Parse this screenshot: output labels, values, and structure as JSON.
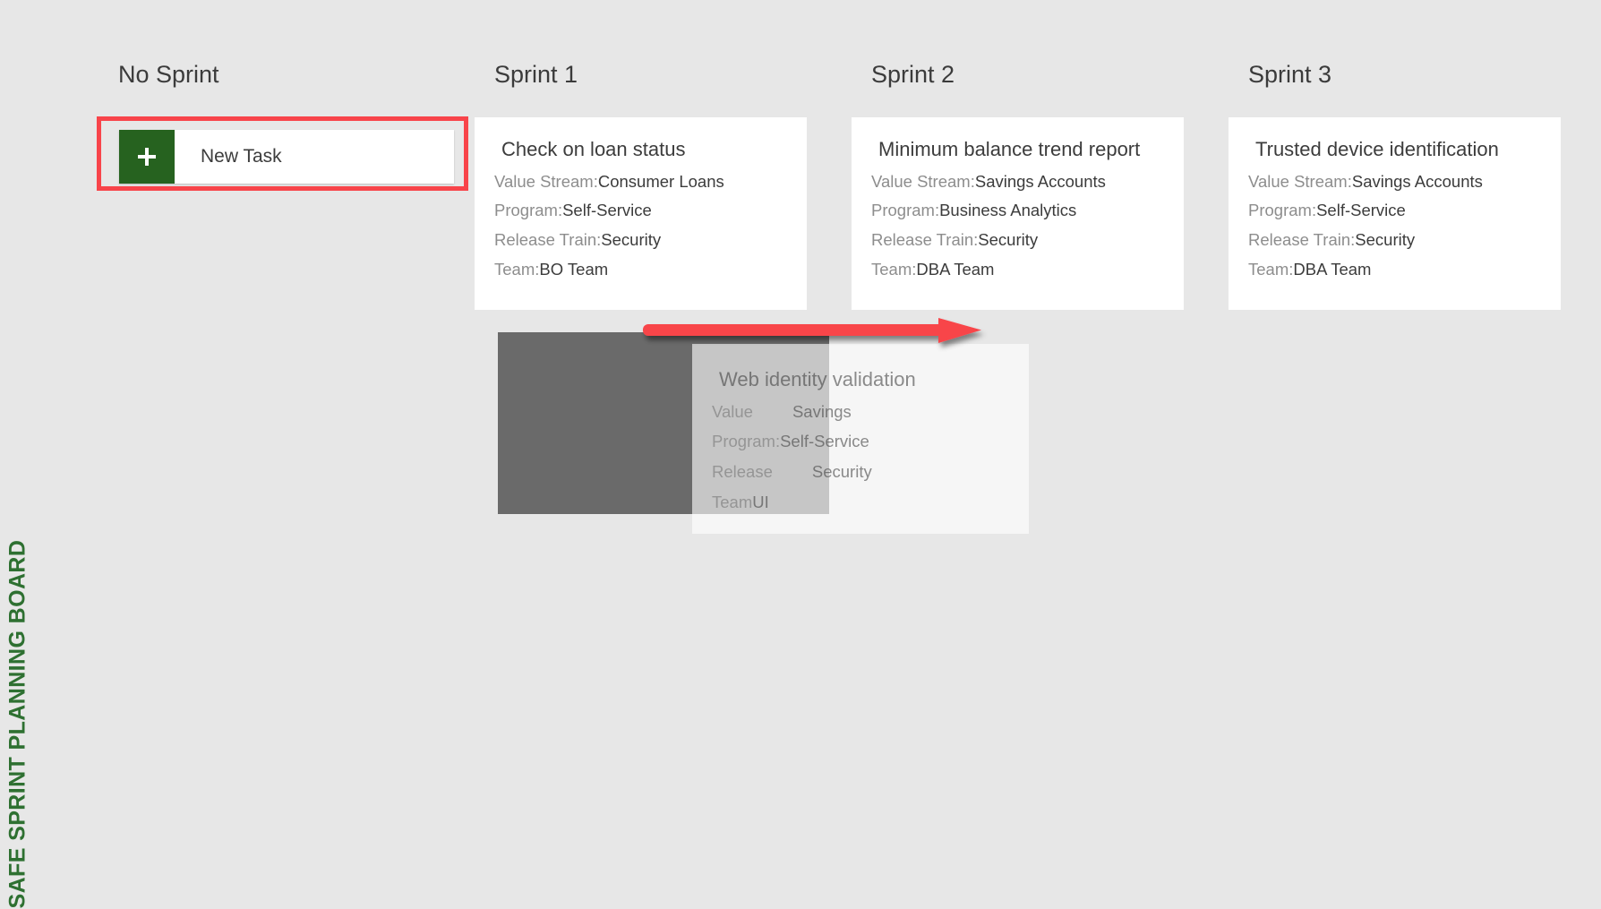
{
  "board": {
    "caption": "SAFE SPRINT PLANNING BOARD",
    "caption_color": "#2e7031",
    "background_color": "#e7e7e7",
    "card_background": "#ffffff",
    "highlight_color": "#f8444a",
    "accent_green": "#26621f"
  },
  "columns": [
    {
      "title": "No Sprint",
      "cards": []
    },
    {
      "title": "Sprint 1",
      "cards": [
        {
          "title": "Check on loan status",
          "fields": [
            {
              "label": "Value Stream:",
              "value": "Consumer Loans"
            },
            {
              "label": "Program:",
              "value": "Self-Service"
            },
            {
              "label": "Release Train:",
              "value": "Security"
            },
            {
              "label": "Team:",
              "value": "BO Team"
            }
          ]
        }
      ]
    },
    {
      "title": "Sprint 2",
      "cards": [
        {
          "title": "Minimum balance trend report",
          "fields": [
            {
              "label": "Value Stream:",
              "value": "Savings Accounts"
            },
            {
              "label": "Program:",
              "value": "Business Analytics"
            },
            {
              "label": "Release Train:",
              "value": "Security"
            },
            {
              "label": "Team:",
              "value": "DBA Team"
            }
          ]
        }
      ]
    },
    {
      "title": "Sprint 3",
      "cards": [
        {
          "title": "Trusted device identification",
          "fields": [
            {
              "label": "Value Stream:",
              "value": "Savings Accounts"
            },
            {
              "label": "Program:",
              "value": "Self-Service"
            },
            {
              "label": "Release Train:",
              "value": "Security"
            },
            {
              "label": "Team:",
              "value": "DBA Team"
            }
          ]
        }
      ]
    }
  ],
  "new_task": {
    "label": "New Task",
    "icon": "plus-icon"
  },
  "drag": {
    "ghost_card": {
      "title": "Web identity validation",
      "fields": [
        {
          "label": "Value",
          "value": "Savings"
        },
        {
          "label": "Program:",
          "value": "Self-Service"
        },
        {
          "label": "Release",
          "value": "Security"
        },
        {
          "label": "Team",
          "value": "UI"
        }
      ]
    },
    "arrow": {
      "name": "drag-direction-arrow",
      "color": "#f8444a"
    }
  }
}
